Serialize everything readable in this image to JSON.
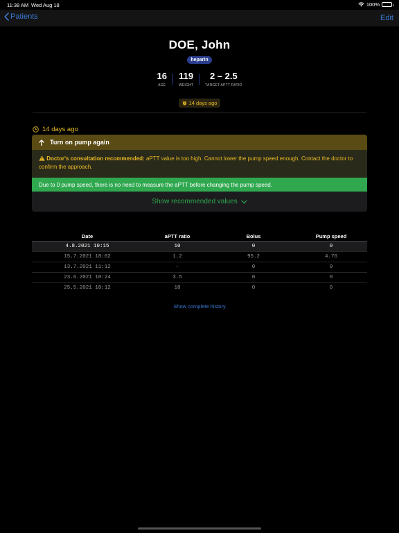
{
  "status_bar": {
    "time": "11:38 AM",
    "date": "Wed Aug 18",
    "battery": "100%"
  },
  "nav": {
    "back_label": "Patients",
    "edit_label": "Edit"
  },
  "patient": {
    "name": "DOE, John",
    "drug": "heparin",
    "stats": [
      {
        "value": "16",
        "label": "AGE"
      },
      {
        "value": "119",
        "label": "WEIGHT"
      },
      {
        "value": "2 – 2.5",
        "label": "TARGET APTT RATIO"
      }
    ],
    "time_badge": "14 days ago"
  },
  "entry": {
    "time": "14 days ago",
    "card": {
      "title": "Turn on pump again",
      "warning_bold": "Doctor's consultation recommended:",
      "warning_text": " aPTT value is too high. Cannot lower the pump speed enough. Contact the doctor to confirm the approach.",
      "info": "Due to 0 pump speed, there is no need to measure the aPTT before changing the pump speed.",
      "action": "Show recommended values"
    }
  },
  "history": {
    "columns": [
      "Date",
      "aPTT ratio",
      "Bolus",
      "Pump speed"
    ],
    "rows": [
      [
        "4.8.2021 10:15",
        "10",
        "0",
        "0"
      ],
      [
        "15.7.2021 18:02",
        "1.2",
        "95.2",
        "4.76"
      ],
      [
        "13.7.2021 11:12",
        "-",
        "0",
        "0"
      ],
      [
        "23.6.2021 10:24",
        "3.5",
        "0",
        "0"
      ],
      [
        "25.5.2021 18:12",
        "18",
        "0",
        "0"
      ]
    ],
    "link": "Show complete history"
  },
  "colors": {
    "accent_blue": "#3a7bd5",
    "warning_yellow": "#e8b824",
    "success_green": "#2fa84f",
    "badge_blue": "#2b3f8e"
  }
}
